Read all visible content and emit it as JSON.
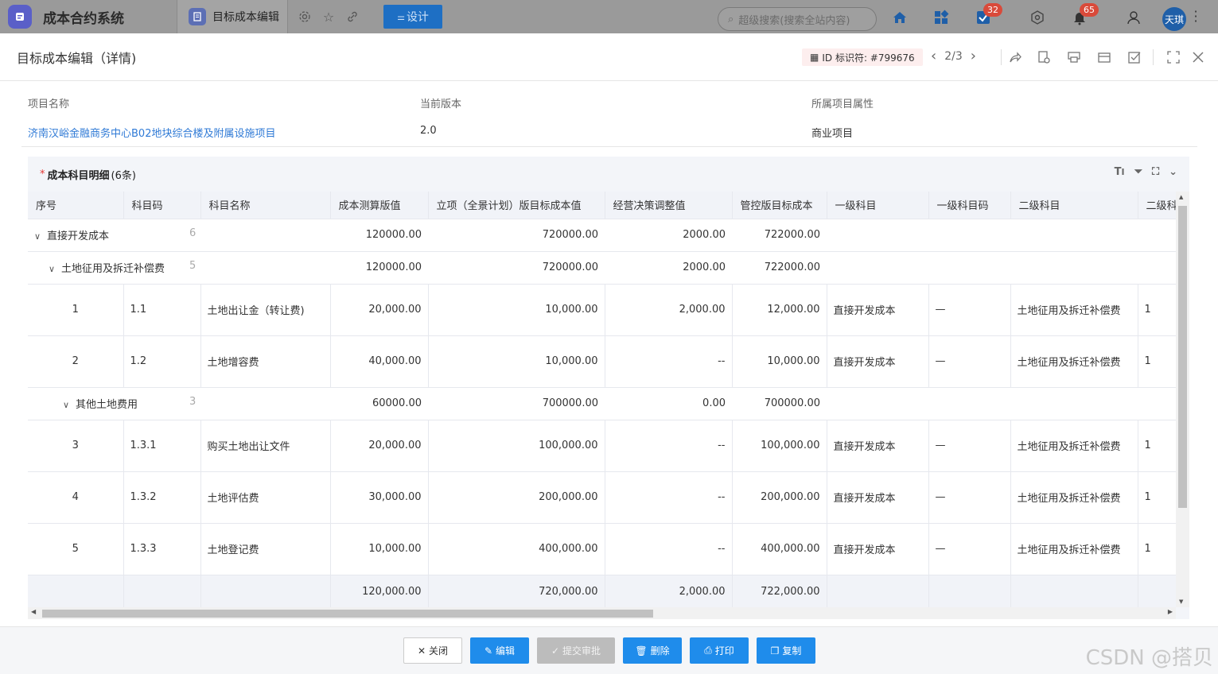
{
  "topbar": {
    "app_name": "成本合约系统",
    "tab_label": "目标成本编辑",
    "design_label": "设计",
    "search_placeholder": "超级搜索(搜索全站内容)",
    "badge_tasks": "32",
    "badge_notifications": "65",
    "avatar_text": "天琪"
  },
  "header": {
    "title": "目标成本编辑（详情)",
    "id_label": "ID 标识符: #799676",
    "pager": "2/3"
  },
  "meta": {
    "project_label": "项目名称",
    "project_value": "济南汉峪金融商务中心B02地块综合楼及附属设施项目",
    "version_label": "当前版本",
    "version_value": "2.0",
    "attr_label": "所属项目属性",
    "attr_value": "商业项目"
  },
  "section": {
    "required_mark": "*",
    "title": "成本科目明细",
    "count": "(6条)"
  },
  "table": {
    "columns": [
      "序号",
      "科目码",
      "科目名称",
      "成本测算版值",
      "立项（全景计划）版目标成本值",
      "经营决策调整值",
      "管控版目标成本",
      "一级科目",
      "一级科目码",
      "二级科目",
      "二级科"
    ],
    "groups": {
      "g1": {
        "name": "直接开发成本",
        "count": "6",
        "c1": "120000.00",
        "c2": "720000.00",
        "c3": "2000.00",
        "c4": "722000.00"
      },
      "g2": {
        "name": "土地征用及拆迁补偿费",
        "count": "5",
        "c1": "120000.00",
        "c2": "720000.00",
        "c3": "2000.00",
        "c4": "722000.00"
      },
      "g3": {
        "name": "其他土地费用",
        "count": "3",
        "c1": "60000.00",
        "c2": "700000.00",
        "c3": "0.00",
        "c4": "700000.00"
      }
    },
    "rows": [
      {
        "seq": "1",
        "code": "1.1",
        "name": "土地出让金（转让费)",
        "v1": "20,000.00",
        "v2": "10,000.00",
        "v3": "2,000.00",
        "v4": "12,000.00",
        "l1": "直接开发成本",
        "l1code": "—",
        "l2": "土地征用及拆迁补偿费",
        "l2code": "1"
      },
      {
        "seq": "2",
        "code": "1.2",
        "name": "土地增容费",
        "v1": "40,000.00",
        "v2": "10,000.00",
        "v3": "--",
        "v4": "10,000.00",
        "l1": "直接开发成本",
        "l1code": "—",
        "l2": "土地征用及拆迁补偿费",
        "l2code": "1"
      },
      {
        "seq": "3",
        "code": "1.3.1",
        "name": "购买土地出让文件",
        "v1": "20,000.00",
        "v2": "100,000.00",
        "v3": "--",
        "v4": "100,000.00",
        "l1": "直接开发成本",
        "l1code": "—",
        "l2": "土地征用及拆迁补偿费",
        "l2code": "1"
      },
      {
        "seq": "4",
        "code": "1.3.2",
        "name": "土地评估费",
        "v1": "30,000.00",
        "v2": "200,000.00",
        "v3": "--",
        "v4": "200,000.00",
        "l1": "直接开发成本",
        "l1code": "—",
        "l2": "土地征用及拆迁补偿费",
        "l2code": "1"
      },
      {
        "seq": "5",
        "code": "1.3.3",
        "name": "土地登记费",
        "v1": "10,000.00",
        "v2": "400,000.00",
        "v3": "--",
        "v4": "400,000.00",
        "l1": "直接开发成本",
        "l1code": "—",
        "l2": "土地征用及拆迁补偿费",
        "l2code": "1"
      }
    ],
    "totals": {
      "v1": "120,000.00",
      "v2": "720,000.00",
      "v3": "2,000.00",
      "v4": "722,000.00"
    }
  },
  "footer": {
    "close": "关闭",
    "edit": "编辑",
    "submit": "提交审批",
    "delete": "删除",
    "print": "打印",
    "copy": "复制",
    "watermark": "CSDN @搭贝"
  }
}
